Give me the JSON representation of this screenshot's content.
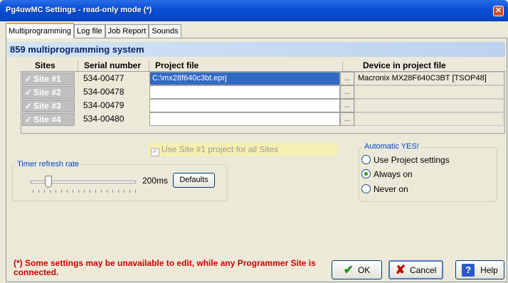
{
  "window": {
    "title": "Pg4uwMC Settings - read-only mode (*)",
    "close_glyph": "✕"
  },
  "tabs": [
    {
      "label": "Multiprogramming",
      "active": true
    },
    {
      "label": "Log file",
      "active": false
    },
    {
      "label": "Job Report",
      "active": false
    },
    {
      "label": "Sounds",
      "active": false
    }
  ],
  "system_title": "859 multiprogramming system",
  "grid": {
    "headers": {
      "sites": "Sites",
      "serial": "Serial number",
      "project": "Project file",
      "device": "Device in project file"
    },
    "rows": [
      {
        "site": "Site #1",
        "serial": "534-00477",
        "project": "C:\\mx28f640c3bt.eprj",
        "device": "Macronix MX28F640C3BT [TSOP48]",
        "browse": "...",
        "selected": true
      },
      {
        "site": "Site #2",
        "serial": "534-00478",
        "project": "",
        "device": "",
        "browse": "...",
        "selected": false
      },
      {
        "site": "Site #3",
        "serial": "534-00479",
        "project": "",
        "device": "",
        "browse": "...",
        "selected": false
      },
      {
        "site": "Site #4",
        "serial": "534-00480",
        "project": "",
        "device": "",
        "browse": "...",
        "selected": false
      }
    ],
    "check_glyph": "✓"
  },
  "use_all_sites": {
    "label": "Use Site #1 project for all Sites",
    "checked": true
  },
  "timer": {
    "legend": "Timer refresh rate",
    "value": "200ms",
    "defaults_label": "Defaults"
  },
  "automatic_yes": {
    "legend": "Automatic YES!",
    "options": [
      {
        "label": "Use Project settings",
        "selected": false
      },
      {
        "label": "Always on",
        "selected": true
      },
      {
        "label": "Never on",
        "selected": false
      }
    ]
  },
  "warning": "(*) Some settings may be unavailable to edit, while any Programmer Site is connected.",
  "buttons": {
    "ok": "OK",
    "cancel": "Cancel",
    "help": "Help",
    "ok_icon": "✔",
    "cancel_icon": "✘",
    "help_icon": "?"
  },
  "colors": {
    "title_bar": "#0a4fd8",
    "system_title": "#0a2468",
    "warning": "#d00000",
    "legend": "#0046d5"
  }
}
